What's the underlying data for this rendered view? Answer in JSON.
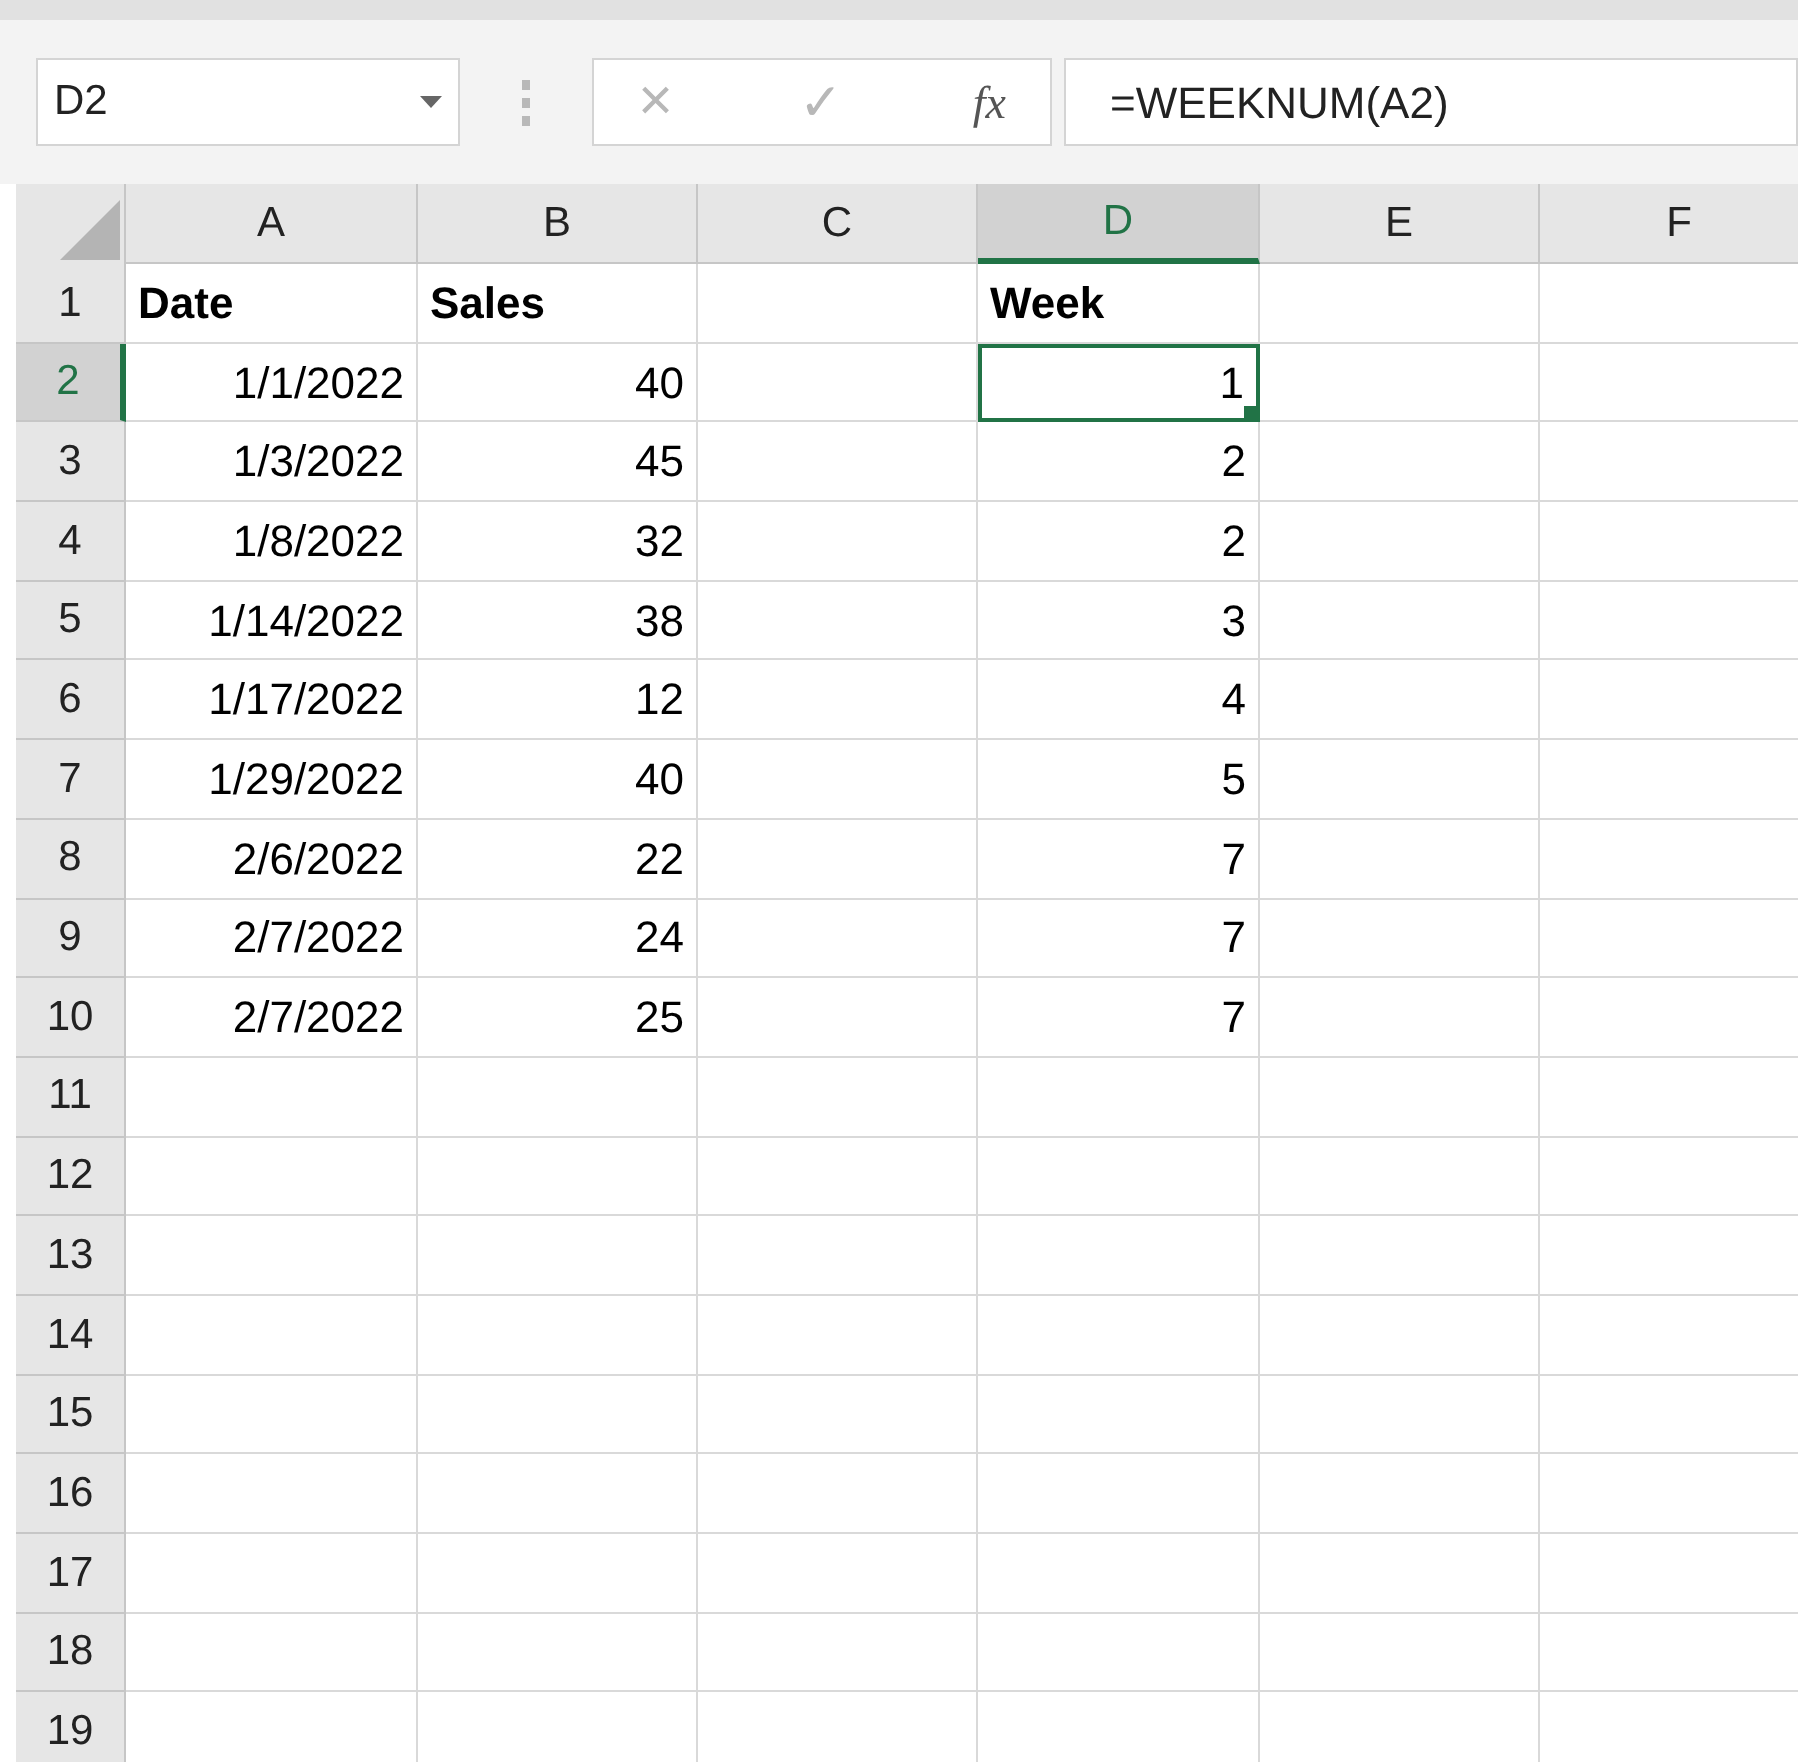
{
  "name_box": {
    "value": "D2"
  },
  "formula_bar": {
    "cancel": "×",
    "enter": "✓",
    "function": "fx",
    "formula": "=WEEKNUM(A2)"
  },
  "columns": [
    {
      "label": "A",
      "selected": false
    },
    {
      "label": "B",
      "selected": false
    },
    {
      "label": "C",
      "selected": false
    },
    {
      "label": "D",
      "selected": true
    },
    {
      "label": "E",
      "selected": false
    },
    {
      "label": "F",
      "selected": false
    }
  ],
  "rows": [
    {
      "number": "1",
      "selected": false,
      "kind": "header",
      "cells": [
        {
          "text": "Date",
          "selected": false
        },
        {
          "text": "Sales",
          "selected": false
        },
        null,
        {
          "text": "Week",
          "selected": false
        },
        null,
        null
      ]
    },
    {
      "number": "2",
      "selected": true,
      "kind": "data",
      "cells": [
        {
          "text": "1/1/2022",
          "selected": false
        },
        {
          "text": "40",
          "selected": false
        },
        null,
        {
          "text": "1",
          "selected": true
        },
        null,
        null
      ]
    },
    {
      "number": "3",
      "selected": false,
      "kind": "data",
      "cells": [
        {
          "text": "1/3/2022",
          "selected": false
        },
        {
          "text": "45",
          "selected": false
        },
        null,
        {
          "text": "2",
          "selected": false
        },
        null,
        null
      ]
    },
    {
      "number": "4",
      "selected": false,
      "kind": "data",
      "cells": [
        {
          "text": "1/8/2022",
          "selected": false
        },
        {
          "text": "32",
          "selected": false
        },
        null,
        {
          "text": "2",
          "selected": false
        },
        null,
        null
      ]
    },
    {
      "number": "5",
      "selected": false,
      "kind": "data",
      "cells": [
        {
          "text": "1/14/2022",
          "selected": false
        },
        {
          "text": "38",
          "selected": false
        },
        null,
        {
          "text": "3",
          "selected": false
        },
        null,
        null
      ]
    },
    {
      "number": "6",
      "selected": false,
      "kind": "data",
      "cells": [
        {
          "text": "1/17/2022",
          "selected": false
        },
        {
          "text": "12",
          "selected": false
        },
        null,
        {
          "text": "4",
          "selected": false
        },
        null,
        null
      ]
    },
    {
      "number": "7",
      "selected": false,
      "kind": "data",
      "cells": [
        {
          "text": "1/29/2022",
          "selected": false
        },
        {
          "text": "40",
          "selected": false
        },
        null,
        {
          "text": "5",
          "selected": false
        },
        null,
        null
      ]
    },
    {
      "number": "8",
      "selected": false,
      "kind": "data",
      "cells": [
        {
          "text": "2/6/2022",
          "selected": false
        },
        {
          "text": "22",
          "selected": false
        },
        null,
        {
          "text": "7",
          "selected": false
        },
        null,
        null
      ]
    },
    {
      "number": "9",
      "selected": false,
      "kind": "data",
      "cells": [
        {
          "text": "2/7/2022",
          "selected": false
        },
        {
          "text": "24",
          "selected": false
        },
        null,
        {
          "text": "7",
          "selected": false
        },
        null,
        null
      ]
    },
    {
      "number": "10",
      "selected": false,
      "kind": "data",
      "cells": [
        {
          "text": "2/7/2022",
          "selected": false
        },
        {
          "text": "25",
          "selected": false
        },
        null,
        {
          "text": "7",
          "selected": false
        },
        null,
        null
      ]
    },
    {
      "number": "11",
      "selected": false
    },
    {
      "number": "12",
      "selected": false
    },
    {
      "number": "13",
      "selected": false
    },
    {
      "number": "14",
      "selected": false
    },
    {
      "number": "15",
      "selected": false
    },
    {
      "number": "16",
      "selected": false
    },
    {
      "number": "17",
      "selected": false
    },
    {
      "number": "18",
      "selected": false
    },
    {
      "number": "19",
      "selected": false
    }
  ]
}
